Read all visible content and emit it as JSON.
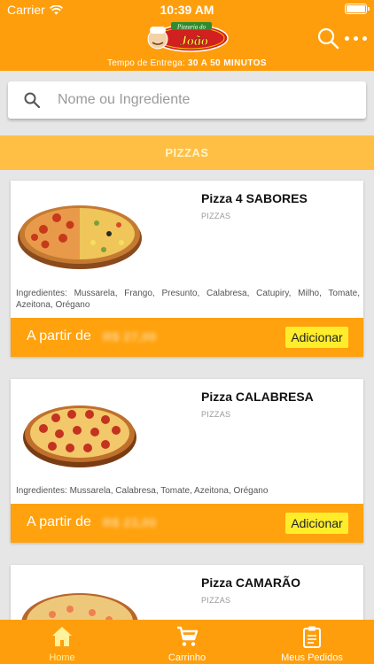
{
  "status_bar": {
    "carrier": "Carrier",
    "time": "10:39 AM"
  },
  "header": {
    "logo_text_top": "Pizzaria do",
    "logo_text_main": "João",
    "delivery_label": "Tempo de Entrega:",
    "delivery_value": "30 A 50 MINUTOS"
  },
  "search": {
    "placeholder": "Nome ou Ingrediente"
  },
  "category": "PIZZAS",
  "products": [
    {
      "name": "Pizza 4 SABORES",
      "category": "PIZZAS",
      "ingredients": "Ingredientes: Mussarela, Frango, Presunto, Calabresa, Catupiry, Milho, Tomate, Azeitona, Orégano",
      "price_label": "A partir de",
      "price": "R$ 27,00",
      "add_label": "Adicionar"
    },
    {
      "name": "Pizza CALABRESA",
      "category": "PIZZAS",
      "ingredients": "Ingredientes: Mussarela, Calabresa, Tomate, Azeitona, Orégano",
      "price_label": "A partir de",
      "price": "R$ 23,00",
      "add_label": "Adicionar"
    },
    {
      "name": "Pizza CAMARÃO",
      "category": "PIZZAS"
    }
  ],
  "tabs": [
    {
      "label": "Home",
      "icon": "home-icon",
      "active": true
    },
    {
      "label": "Carrinho",
      "icon": "cart-icon",
      "active": false
    },
    {
      "label": "Meus Pedidos",
      "icon": "clipboard-icon",
      "active": false
    }
  ],
  "colors": {
    "primary": "#ff9e0c",
    "add_button": "#ffed2c",
    "category_band": "#ffbf45"
  }
}
